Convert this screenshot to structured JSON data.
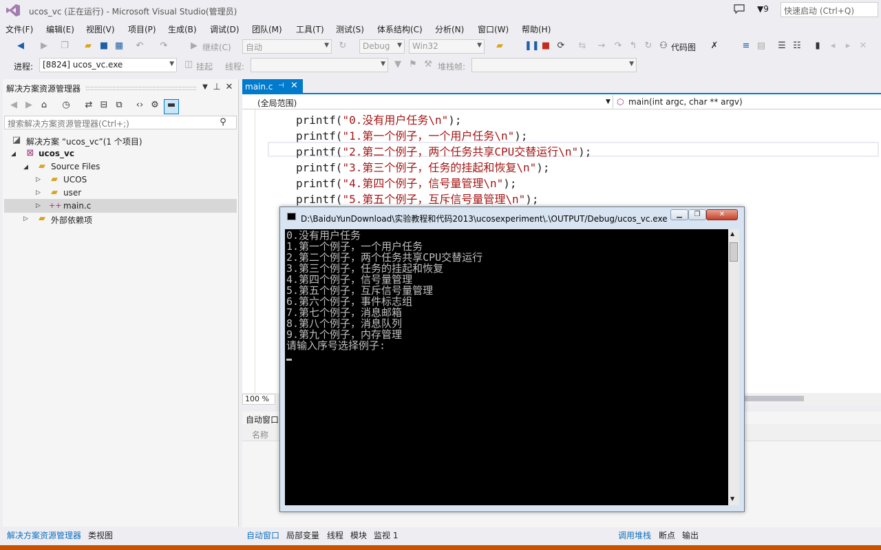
{
  "window": {
    "title": "ucos_vc (正在运行) - Microsoft Visual Studio(管理员)",
    "notification_count": "9",
    "quick_launch_placeholder": "快速启动 (Ctrl+Q)"
  },
  "menu": [
    "文件(F)",
    "编辑(E)",
    "视图(V)",
    "项目(P)",
    "生成(B)",
    "调试(D)",
    "团队(M)",
    "工具(T)",
    "测试(S)",
    "体系结构(C)",
    "分析(N)",
    "窗口(W)",
    "帮助(H)"
  ],
  "toolbar": {
    "continue_label": "继续(C)",
    "config_auto": "自动",
    "config_debug": "Debug",
    "platform": "Win32",
    "code_map_label": "代码图",
    "process_label": "进程:",
    "process_value": "[8824] ucos_vc.exe",
    "suspend_label": "挂起",
    "thread_label": "线程:",
    "stack_frame_label": "堆栈帧:"
  },
  "solution_explorer": {
    "title": "解决方案资源管理器",
    "search_placeholder": "搜索解决方案资源管理器(Ctrl+;)",
    "solution_label": "解决方案 “ucos_vc”(1 个项目)",
    "project": "ucos_vc",
    "source_files": "Source Files",
    "folder_ucos": "UCOS",
    "folder_user": "user",
    "file_main": "main.c",
    "external_deps": "外部依赖项"
  },
  "editor": {
    "tab_label": "main.c",
    "scope": "(全局范围)",
    "function": "main(int argc, char ** argv)",
    "zoom": "100 %",
    "lines": [
      {
        "fn": "printf(",
        "str": "\"0.没有用户任务\\n\"",
        "end": ");"
      },
      {
        "fn": "printf(",
        "str": "\"1.第一个例子，一个用户任务\\n\"",
        "end": ");"
      },
      {
        "fn": "printf(",
        "str": "\"2.第二个例子，两个任务共享CPU交替运行\\n\"",
        "end": ");"
      },
      {
        "fn": "printf(",
        "str": "\"3.第三个例子，任务的挂起和恢复\\n\"",
        "end": ");"
      },
      {
        "fn": "printf(",
        "str": "\"4.第四个例子，信号量管理\\n\"",
        "end": ");"
      },
      {
        "fn": "printf(",
        "str": "\"5.第五个例子，互斥信号量管理\\n\"",
        "end": ");"
      }
    ]
  },
  "autos": {
    "title": "自动窗口",
    "col_name": "名称"
  },
  "bottom_tabs_left": [
    "解决方案资源管理器",
    "类视图"
  ],
  "bottom_tabs_mid": [
    "自动窗口",
    "局部变量",
    "线程",
    "模块",
    "监视 1"
  ],
  "bottom_tabs_right": [
    "调用堆栈",
    "断点",
    "输出"
  ],
  "console": {
    "title": "D:\\BaiduYunDownload\\实验教程和代码2013\\ucosexperiment\\.\\OUTPUT/Debug/ucos_vc.exe",
    "lines": [
      "0.没有用户任务",
      "1.第一个例子，一个用户任务",
      "2.第二个例子，两个任务共享CPU交替运行",
      "3.第三个例子，任务的挂起和恢复",
      "4.第四个例子，信号量管理",
      "5.第五个例子，互斥信号量管理",
      "6.第六个例子，事件标志组",
      "7.第七个例子，消息邮箱",
      "8.第八个例子，消息队列",
      "9.第九个例子，内存管理",
      "请输入序号选择例子:"
    ]
  },
  "colors": {
    "accent": "#007acc",
    "status": "#ca5100",
    "string": "#a31515"
  }
}
